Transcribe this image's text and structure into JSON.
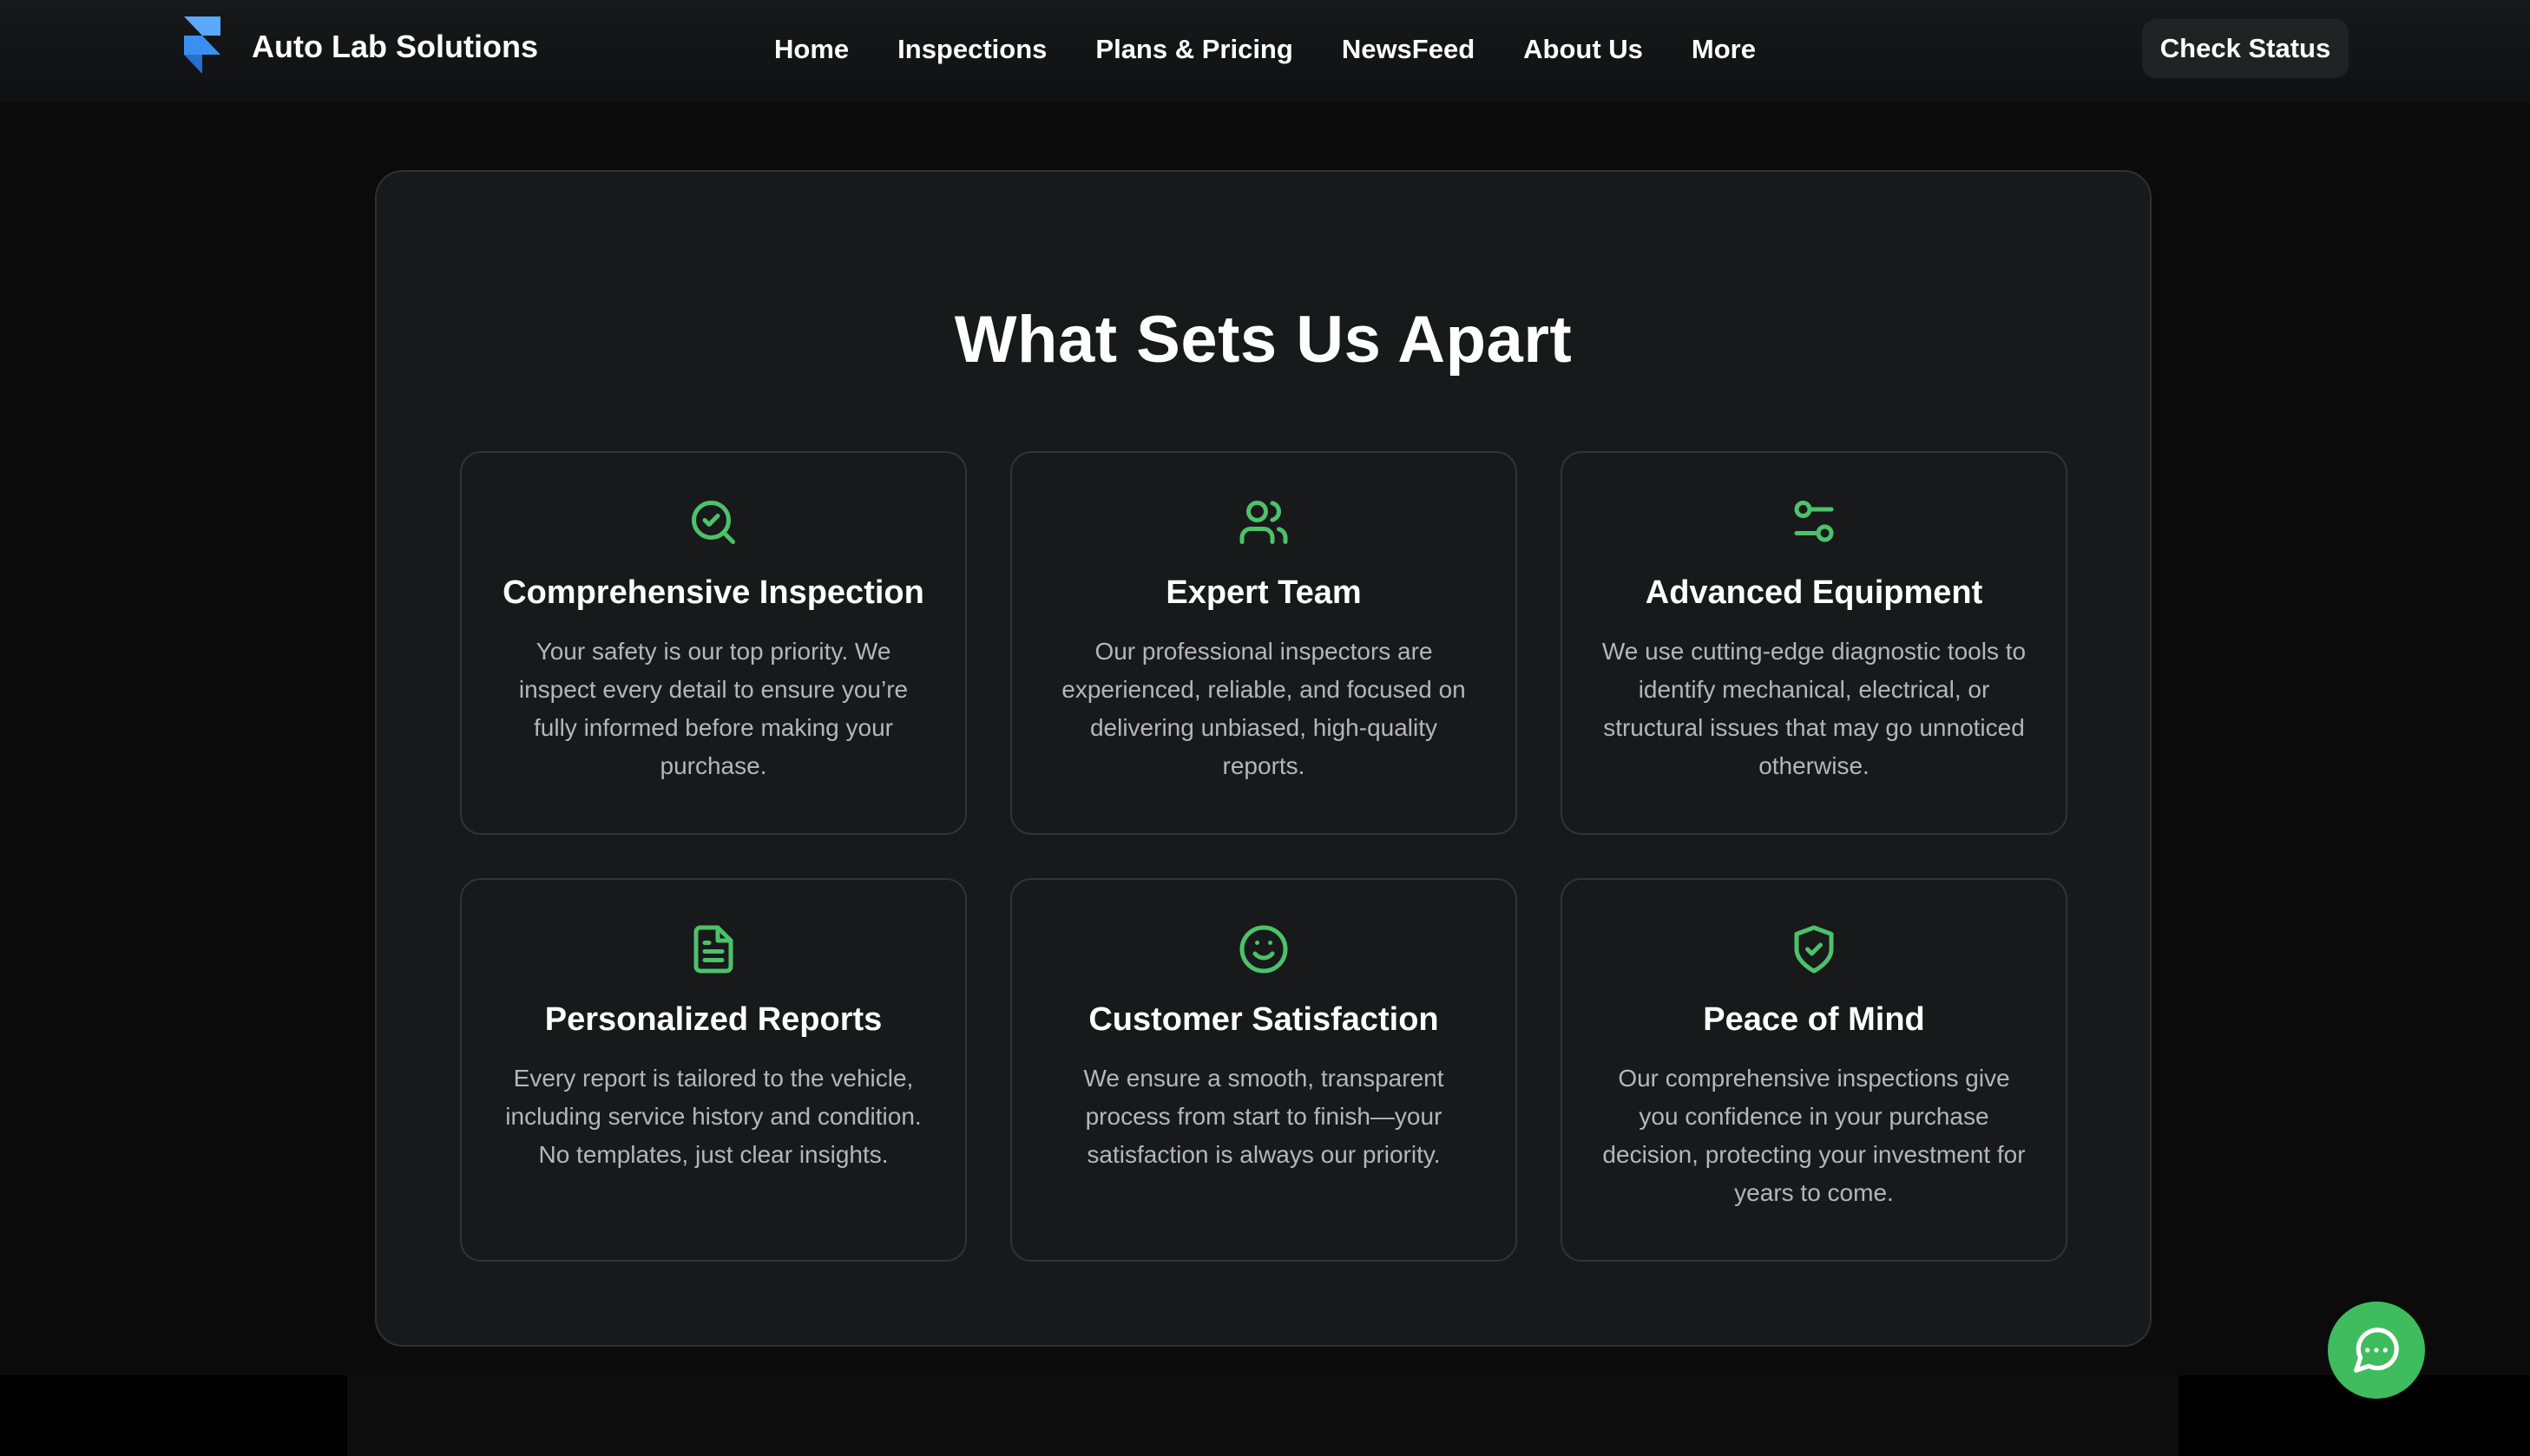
{
  "header": {
    "brand_name": "Auto Lab Solutions",
    "logo_icon": "framer-logo-icon",
    "nav": [
      {
        "label": "Home"
      },
      {
        "label": "Inspections"
      },
      {
        "label": "Plans & Pricing"
      },
      {
        "label": "NewsFeed"
      },
      {
        "label": "About Us"
      },
      {
        "label": "More"
      }
    ],
    "cta_label": "Check Status"
  },
  "main": {
    "section_title": "What Sets Us Apart",
    "features": [
      {
        "icon": "search-check-icon",
        "title": "Comprehensive Inspection",
        "text": "Your safety is our top priority. We inspect every detail to ensure you’re fully informed before making your purchase."
      },
      {
        "icon": "users-icon",
        "title": "Expert Team",
        "text": "Our professional inspectors are experienced, reliable, and focused on delivering unbiased, high-quality reports."
      },
      {
        "icon": "settings-sliders-icon",
        "title": "Advanced Equipment",
        "text": "We use cutting-edge diagnostic tools to identify mechanical, electrical, or structural issues that may go unnoticed otherwise."
      },
      {
        "icon": "document-icon",
        "title": "Personalized Reports",
        "text": "Every report is tailored to the vehicle, including service history and condition. No templates, just clear insights."
      },
      {
        "icon": "smile-icon",
        "title": "Customer Satisfaction",
        "text": "We ensure a smooth, transparent process from start to finish—your satisfaction is always our priority."
      },
      {
        "icon": "shield-check-icon",
        "title": "Peace of Mind",
        "text": "Our comprehensive inspections give you confidence in your purchase decision, protecting your investment for years to come."
      }
    ]
  },
  "chat_widget": {
    "icon": "chat-bubble-icon"
  },
  "colors": {
    "accent_green": "#4cc26a",
    "chat_green": "#3fbd5e",
    "logo_blue": "#3a8ff0",
    "background": "#0b0b0c",
    "panel": "#18191b"
  }
}
